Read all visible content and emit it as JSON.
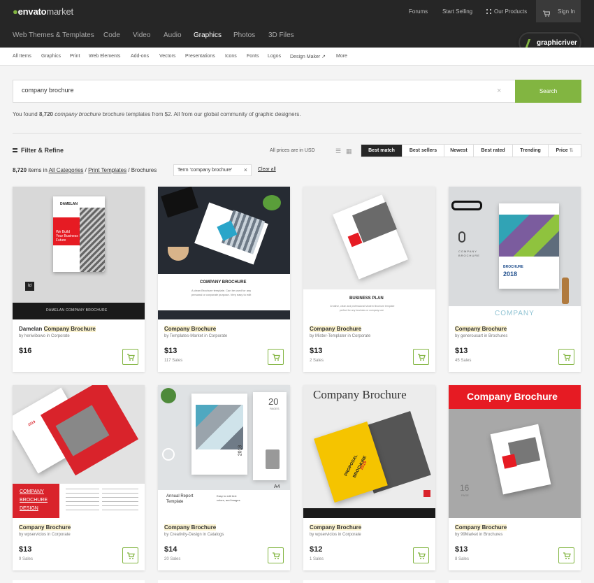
{
  "header": {
    "logo_brand": "envato",
    "logo_market": "market",
    "forums": "Forums",
    "start_selling": "Start Selling",
    "our_products": "Our Products",
    "sign_in": "Sign In"
  },
  "nav": {
    "items": [
      "Web Themes & Templates",
      "Code",
      "Video",
      "Audio",
      "Graphics",
      "Photos",
      "3D Files"
    ],
    "active": "Graphics",
    "badge": "graphicriver"
  },
  "subnav": [
    "All Items",
    "Graphics",
    "Print",
    "Web Elements",
    "Add-ons",
    "Vectors",
    "Presentations",
    "Icons",
    "Fonts",
    "Logos",
    "Design Maker",
    "More"
  ],
  "search": {
    "value": "company brochure",
    "button": "Search",
    "clear": "×"
  },
  "results": {
    "found_prefix": "You found ",
    "count": "8,720",
    "query": "company brochure",
    "found_suffix": " brochure templates from $2. All from our global community of graphic designers."
  },
  "filter": {
    "label": "Filter & Refine",
    "prices_note": "All prices are in USD"
  },
  "sort": {
    "options": [
      "Best match",
      "Best sellers",
      "Newest",
      "Best rated",
      "Trending",
      "Price"
    ],
    "active": "Best match"
  },
  "breadcrumb": {
    "count": "8,720",
    "items_in": " items in ",
    "cat1": "All Categories",
    "sep": " / ",
    "cat2": "Print Templates",
    "cat3": "Brochures",
    "term": "Term 'company brochure'",
    "clear_all": "Clear all"
  },
  "colors": {
    "accent": "#82b541",
    "dark": "#262626",
    "highlight": "#fbf3d0",
    "red": "#e61b23"
  },
  "items": [
    {
      "prefix": "Damelan ",
      "title": "Company Brochure",
      "by": "by heriwibowo in Corporate",
      "price": "$16",
      "sales": "",
      "thumb": {
        "brand": "DAMELAN",
        "t1": "We Build",
        "t2": "Your Business",
        "t3": "Future",
        "foot": "DAMELAN COMPANY BROCHURE",
        "icon": "Id"
      }
    },
    {
      "prefix": "",
      "title": "Company Brochure",
      "by": "by Templates-Market in Corporate",
      "price": "$13",
      "sales": "117 Sales",
      "thumb": {
        "t1": "COMPANY BROCHURE",
        "t2": "A clean Brochure template. Can be used for any",
        "t3": "personal or corporate purpose. Very easy to edit"
      }
    },
    {
      "prefix": "",
      "title": "Company Brochure",
      "by": "by Mister-Templater in Corporate",
      "price": "$13",
      "sales": "2 Sales",
      "thumb": {
        "t1": "BUSINESS PLAN",
        "t2": "Creative, clean and professional Modern Brochure template",
        "t3": "perfect for any business or company use"
      }
    },
    {
      "prefix": "",
      "title": "Company Brochure",
      "by": "by generousart in Brochures",
      "price": "$13",
      "sales": "45 Sales",
      "thumb": {
        "t1": "COMPANY",
        "t2": "BROCHURE",
        "t3": "2018",
        "foot": "COMPANY"
      }
    },
    {
      "prefix": "",
      "title": "Company Brochure",
      "by": "by wpservicios in Corporate",
      "price": "$13",
      "sales": "9 Sales",
      "thumb": {
        "t1": "COMPANY",
        "t2": "BROCHURE",
        "t3": "DESIGN",
        "t4": "2019"
      }
    },
    {
      "prefix": "",
      "title": "Company Brochure",
      "by": "by Creativity-Design in Catalogs",
      "price": "$14",
      "sales": "20 Sales",
      "thumb": {
        "t1": "Annual Report",
        "t2": "Template",
        "t3": "Easy to edit text",
        "t4": "colors, and images",
        "n": "20",
        "pages": "PAGES",
        "yr": "2018",
        "a4": "A4"
      }
    },
    {
      "prefix": "",
      "title": "Company Brochure",
      "by": "by wpservicios in Corporate",
      "price": "$12",
      "sales": "1 Sales",
      "thumb": {
        "t1": "Company Brochure",
        "t2": "PROPOSAL",
        "t3": "BROCHURE",
        "t4": "2019"
      }
    },
    {
      "prefix": "",
      "title": "Company Brochure",
      "by": "by 99Market in Brochures",
      "price": "$13",
      "sales": "8 Sales",
      "thumb": {
        "t1": "Company Brochure",
        "n": "16",
        "pages": "PAGE"
      }
    }
  ]
}
